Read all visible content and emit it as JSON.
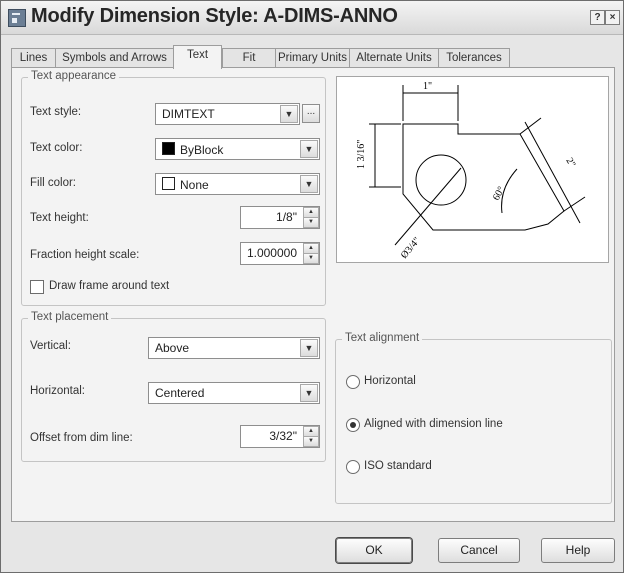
{
  "window": {
    "title": "Modify Dimension Style: A-DIMS-ANNO",
    "help_glyph": "?",
    "close_glyph": "×"
  },
  "tabs": [
    {
      "label": "Lines",
      "active": false
    },
    {
      "label": "Symbols and Arrows",
      "active": false
    },
    {
      "label": "Text",
      "active": true
    },
    {
      "label": "Fit",
      "active": false
    },
    {
      "label": "Primary Units",
      "active": false
    },
    {
      "label": "Alternate Units",
      "active": false
    },
    {
      "label": "Tolerances",
      "active": false
    }
  ],
  "text_appearance": {
    "group_label": "Text appearance",
    "text_style_label": "Text style:",
    "text_style_value": "DIMTEXT",
    "text_style_button": "...",
    "text_color_label": "Text color:",
    "text_color_value": "ByBlock",
    "fill_color_label": "Fill color:",
    "fill_color_value": "None",
    "text_height_label": "Text height:",
    "text_height_value": "1/8\"",
    "fraction_scale_label": "Fraction height scale:",
    "fraction_scale_value": "1.000000",
    "frame_label": "Draw frame around text",
    "frame_checked": false
  },
  "text_placement": {
    "group_label": "Text placement",
    "vertical_label": "Vertical:",
    "vertical_value": "Above",
    "horizontal_label": "Horizontal:",
    "horizontal_value": "Centered",
    "offset_label": "Offset from dim line:",
    "offset_value": "3/32\""
  },
  "text_alignment": {
    "group_label": "Text alignment",
    "options": [
      {
        "label": "Horizontal",
        "selected": false
      },
      {
        "label": "Aligned with dimension line",
        "selected": true
      },
      {
        "label": "ISO standard",
        "selected": false
      }
    ]
  },
  "preview": {
    "dim_top": "1\"",
    "dim_left": "1 3/16\"",
    "dim_right": "2\"",
    "dim_angle": "60°",
    "dim_diameter": "Ø3/4\""
  },
  "buttons": {
    "ok": "OK",
    "cancel": "Cancel",
    "help": "Help"
  },
  "icons": {
    "app": "dialog-app-icon",
    "dropdown": "chevron-down-icon",
    "spinner": "spinner-arrows-icon"
  }
}
